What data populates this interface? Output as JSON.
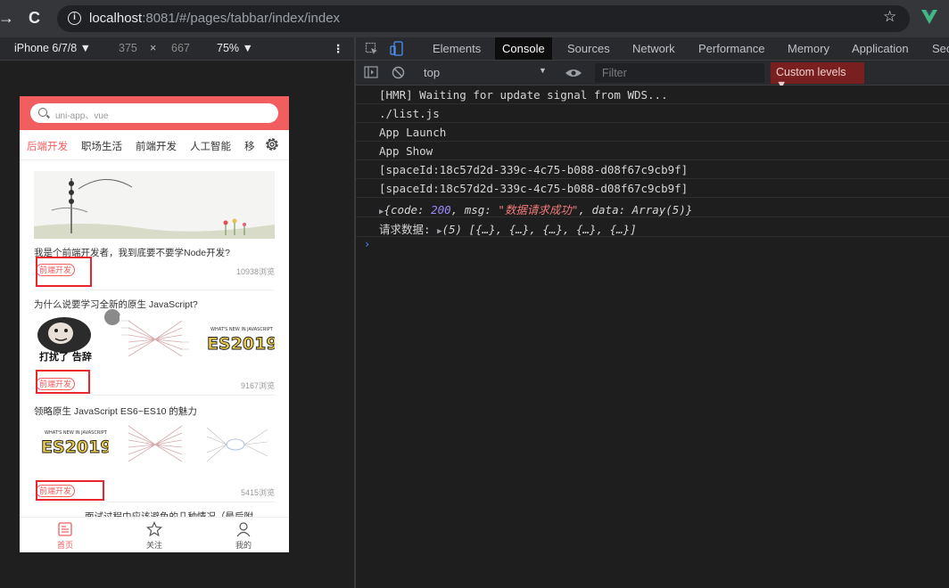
{
  "browser": {
    "back_glyph": "→",
    "reload_glyph": "C",
    "url_host": "localhost",
    "url_rest": ":8081/#/pages/tabbar/index/index",
    "star_glyph": "☆"
  },
  "device_toolbar": {
    "device": "iPhone 6/7/8 ▼",
    "width": "375",
    "times": "×",
    "height": "667",
    "zoom": "75% ▼",
    "more": "⋮"
  },
  "phone": {
    "search_placeholder": "uni-app、vue",
    "tabs": [
      "后端开发",
      "职场生活",
      "前端开发",
      "人工智能",
      "移"
    ],
    "items": [
      {
        "title": "我是个前端开发者，我到底要不要学Node开发?",
        "tag": "前端开发",
        "views": "10938浏览"
      },
      {
        "title": "为什么说要学习全新的原生 JavaScript?",
        "tag": "前端开发",
        "views": "9167浏览"
      },
      {
        "title": "领略原生 JavaScript ES6~ES10 的魅力",
        "tag": "前端开发",
        "views": "5415浏览"
      },
      {
        "title": "面试过程中应该避免的几种情况（最后附"
      }
    ],
    "thumb_caption": "打扰了 告辞",
    "es_badge": "ES2019",
    "es_small": "WHAT'S NEW IN JAVASCRIPT",
    "footer": [
      "首页",
      "关注",
      "我的"
    ]
  },
  "devtools": {
    "tabs": [
      "Elements",
      "Console",
      "Sources",
      "Network",
      "Performance",
      "Memory",
      "Application",
      "Sec"
    ],
    "context": "top",
    "filter_placeholder": "Filter",
    "levels": "Custom levels ▼"
  },
  "console": {
    "l1": "[HMR] Waiting for update signal from WDS...",
    "l2": "./list.js",
    "l3": "App Launch",
    "l4": "App Show",
    "l5": "[spaceId:18c57d2d-339c-4c75-b088-d08f67c9cb9f]",
    "l6": "[spaceId:18c57d2d-339c-4c75-b088-d08f67c9cb9f]",
    "obj_open": "{code: ",
    "obj_code": "200",
    "obj_msg_key": ", msg: ",
    "obj_msg": "\"数据请求成功\"",
    "obj_data": ", data: Array(5)}",
    "req_label": "请求数据: ",
    "req_value": "(5) [{…}, {…}, {…}, {…}, {…}]"
  }
}
